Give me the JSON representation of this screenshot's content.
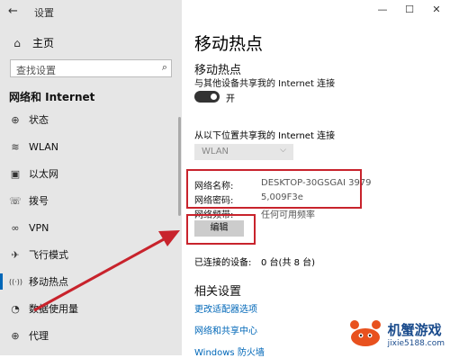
{
  "sidebar": {
    "back_glyph": "←",
    "app_title": "设置",
    "home_label": "主页",
    "search_placeholder": "查找设置",
    "section_title": "网络和 Internet",
    "items": [
      {
        "label": "状态",
        "icon": "status-icon",
        "glyph": "⊕"
      },
      {
        "label": "WLAN",
        "icon": "wifi-icon",
        "glyph": "≋"
      },
      {
        "label": "以太网",
        "icon": "ethernet-icon",
        "glyph": "▣"
      },
      {
        "label": "拨号",
        "icon": "dialup-icon",
        "glyph": "☏"
      },
      {
        "label": "VPN",
        "icon": "vpn-icon",
        "glyph": "∞"
      },
      {
        "label": "飞行模式",
        "icon": "airplane-icon",
        "glyph": "✈"
      },
      {
        "label": "移动热点",
        "icon": "hotspot-icon",
        "glyph": "((·))",
        "active": true
      },
      {
        "label": "数据使用量",
        "icon": "data-usage-icon",
        "glyph": "◔"
      },
      {
        "label": "代理",
        "icon": "proxy-icon",
        "glyph": "⊕"
      }
    ]
  },
  "window": {
    "minimize": "—",
    "maximize": "☐",
    "close": "✕"
  },
  "main": {
    "page_title": "移动热点",
    "hotspot_heading": "移动热点",
    "share_label": "与其他设备共享我的 Internet 连接",
    "toggle_state": "开",
    "from_label": "从以下位置共享我的 Internet 连接",
    "dropdown_value": "WLAN",
    "network_name_label": "网络名称:",
    "network_name_value": "DESKTOP-30GSGAI 3979",
    "network_password_label": "网络密码:",
    "network_password_value": "5,009F3e",
    "network_band_label": "网络频带:",
    "network_band_value": "任何可用频率",
    "edit_button": "编辑",
    "connected_label": "已连接的设备:",
    "connected_value": "0 台(共 8 台)",
    "related_heading": "相关设置",
    "links": [
      "更改适配器选项",
      "网络和共享中心",
      "Windows 防火墙"
    ]
  },
  "watermark": {
    "main": "机蟹游戏",
    "sub": "jixie5188.com"
  },
  "colors": {
    "sidebar_bg": "#e6e6e6",
    "accent": "#0067b8",
    "annotation_red": "#c8232c"
  }
}
